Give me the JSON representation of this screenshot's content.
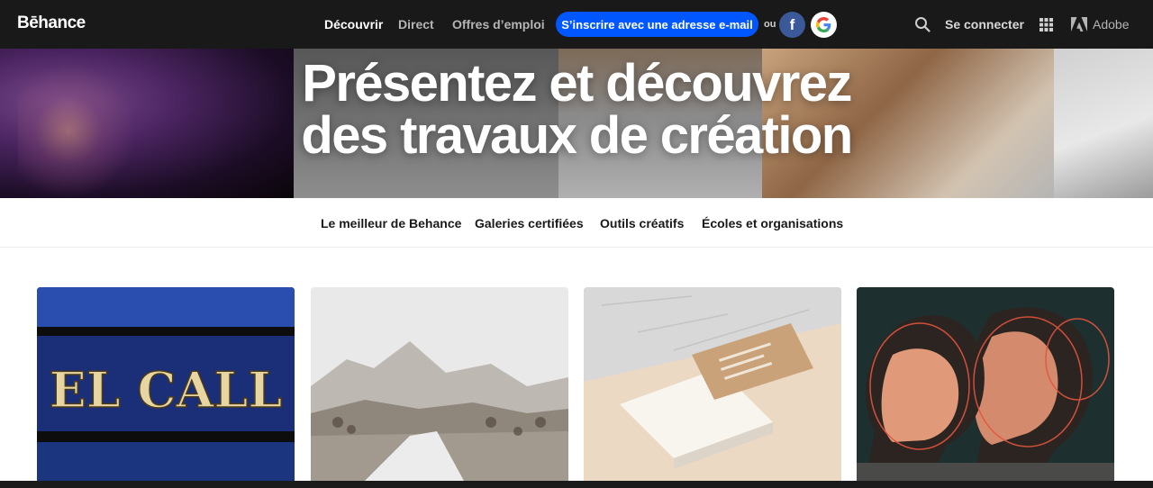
{
  "header": {
    "logo": "Bēhance",
    "nav": [
      "Découvrir",
      "Direct",
      "Offres d’emploi"
    ],
    "signup_label": "S’inscrire avec une adresse e-mail",
    "or_label": "ou",
    "facebook_glyph": "f",
    "google_glyph": "G",
    "signin_label": "Se connecter",
    "adobe_label": "Adobe"
  },
  "hero": {
    "title_line1": "Présentez et découvrez",
    "title_line2": "des travaux de création"
  },
  "subnav": [
    "Le meilleur de Behance",
    "Galeries certifiées",
    "Outils créatifs",
    "Écoles et organisations"
  ],
  "cards": [
    {
      "image": "el-call-sign",
      "sign_text": "EL CALL"
    },
    {
      "image": "snowy-mountain-path"
    },
    {
      "image": "business-cards-on-marble"
    },
    {
      "image": "illustrated-double-portrait"
    }
  ],
  "colors": {
    "nav_bg": "#191919",
    "accent": "#0057ff",
    "facebook": "#3b5998"
  },
  "icons": [
    "search-icon",
    "apps-grid-icon",
    "adobe-logo-icon",
    "facebook-icon",
    "google-icon"
  ]
}
